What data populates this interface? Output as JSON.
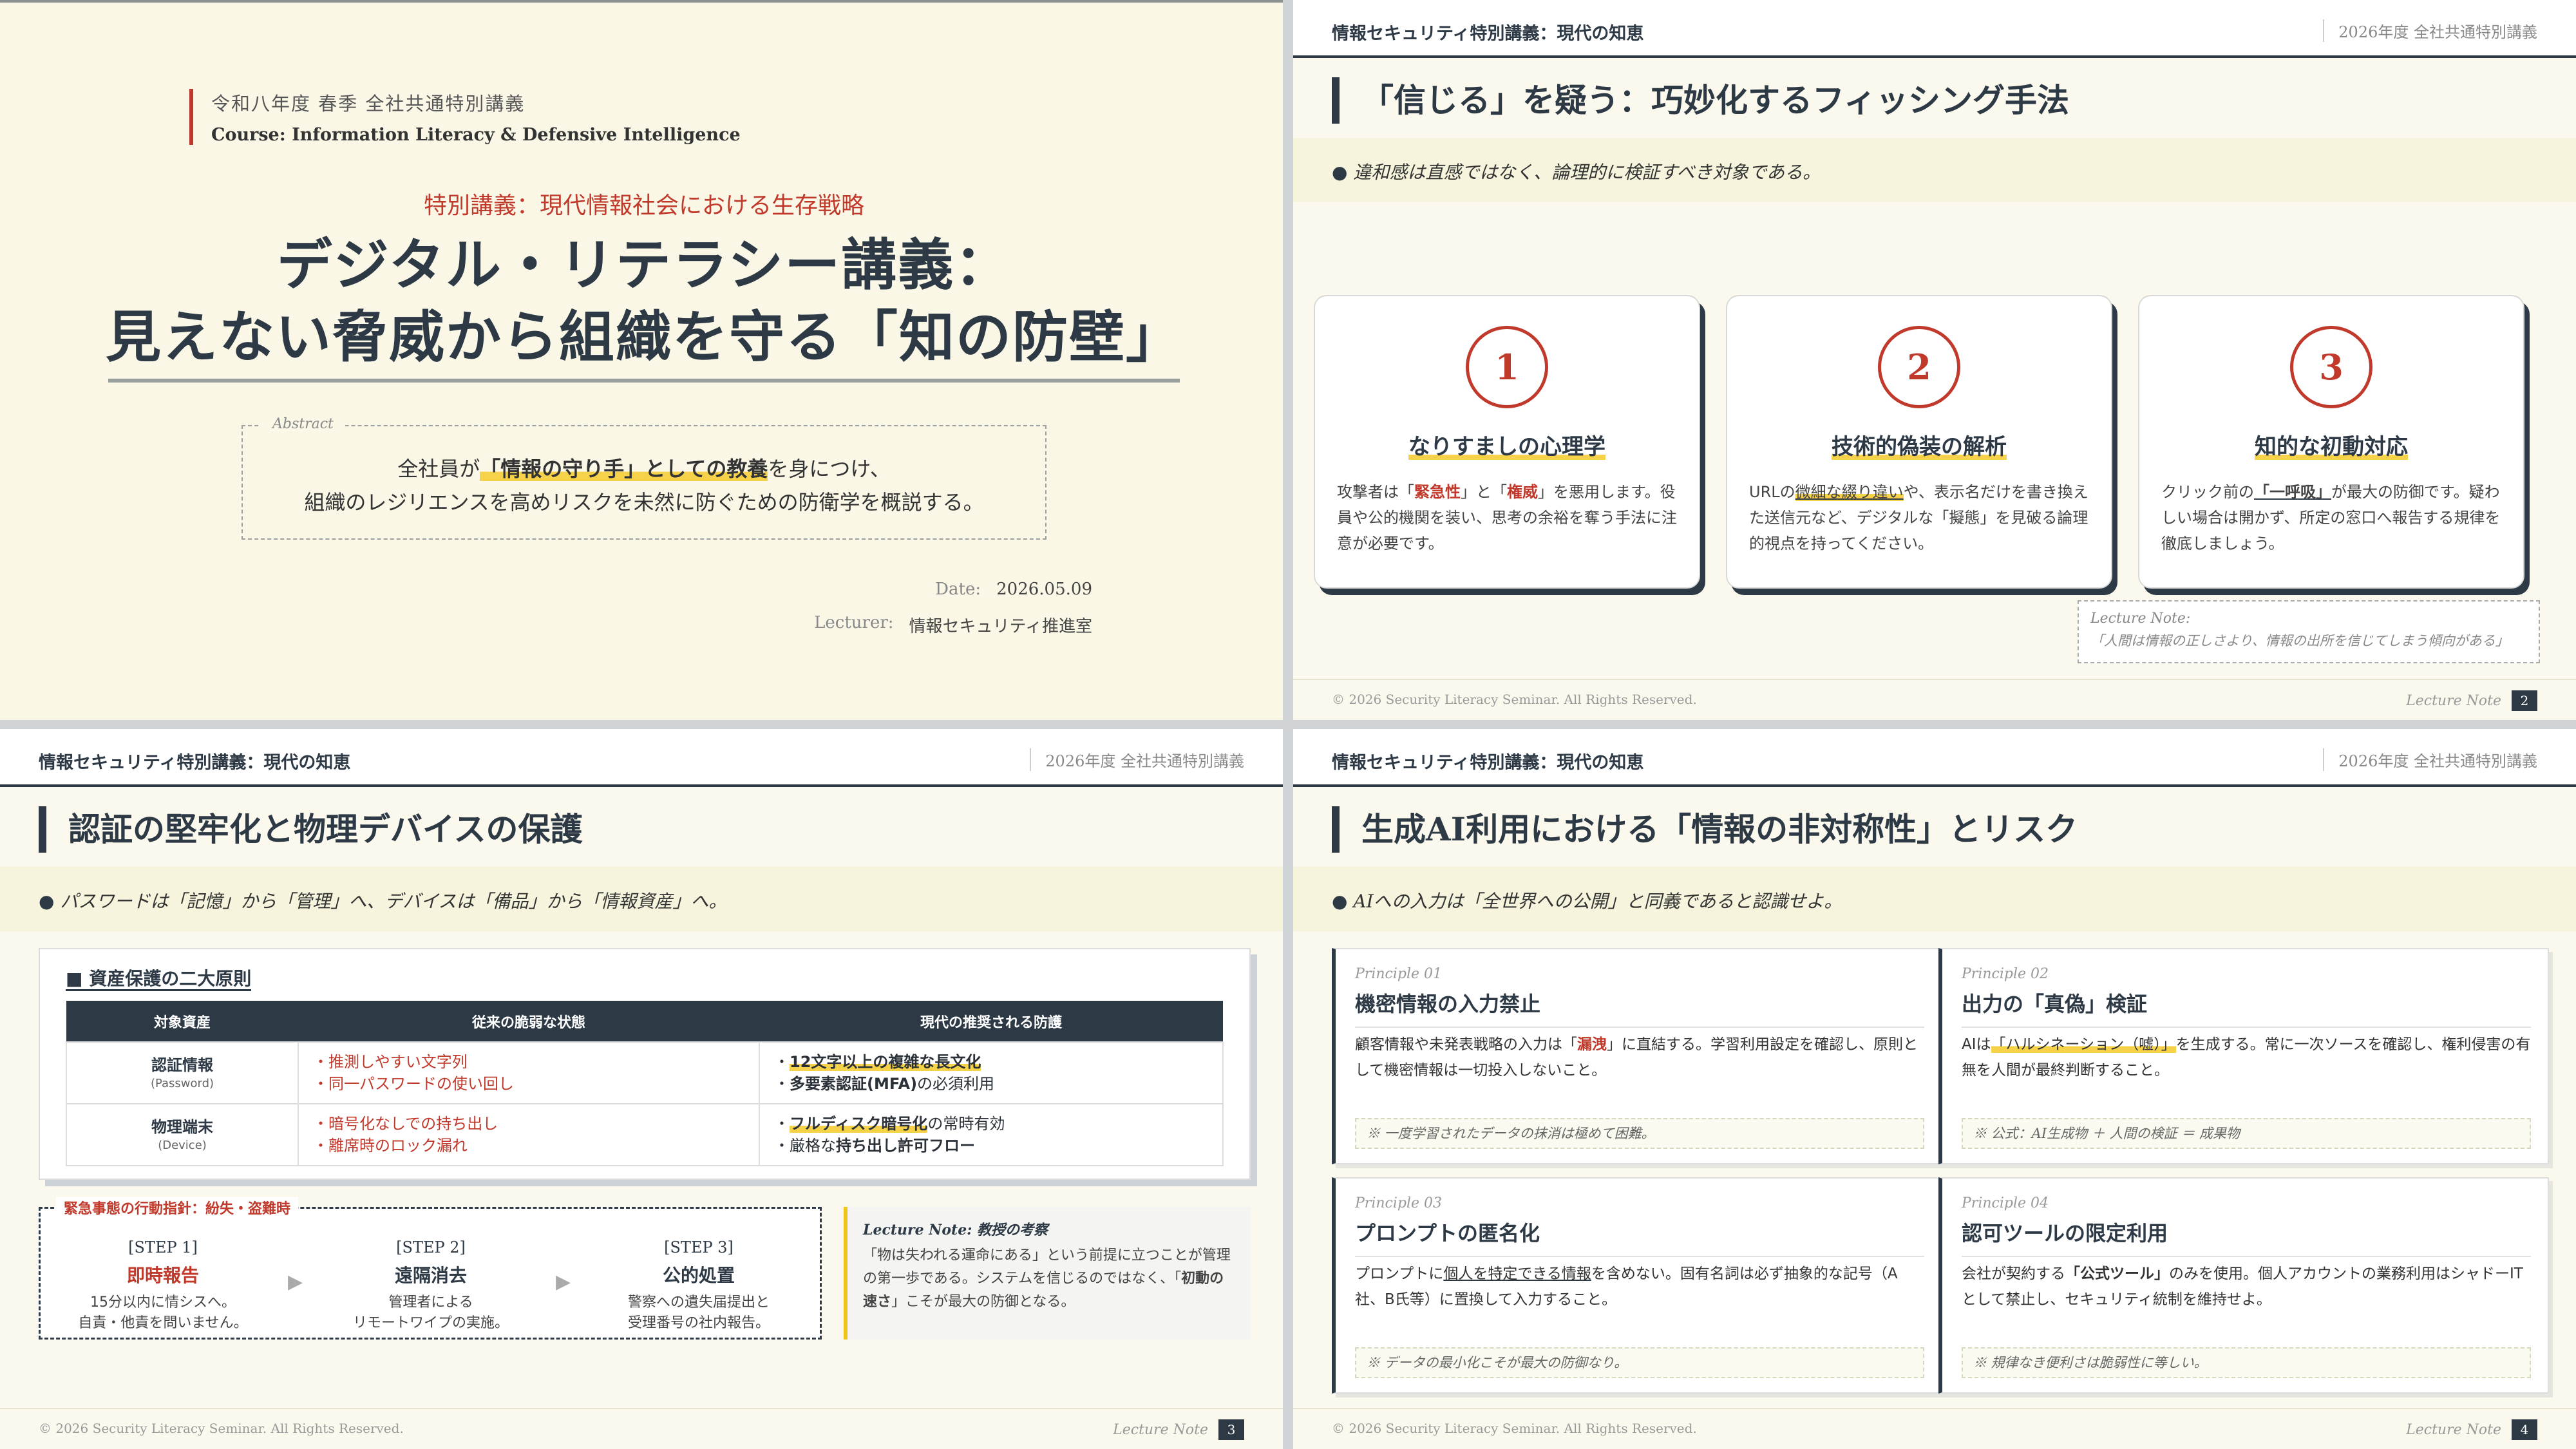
{
  "slide1": {
    "course_jp": "令和八年度 春季 全社共通特別講義",
    "course_en": "Course: Information Literacy & Defensive Intelligence",
    "subtitle": "特別講義：現代情報社会における生存戦略",
    "title_line1": "デジタル・リテラシー講義：",
    "title_line2": "見えない脅威から組織を守る「知の防壁」",
    "abstract_label": "Abstract",
    "abstract_pre": "全社員が",
    "abstract_mark": "「情報の守り手」としての教養",
    "abstract_post": "を身につけ、",
    "abstract_line2": "組織のレジリエンスを高めリスクを未然に防ぐための防衛学を概説する。",
    "date_label": "Date:",
    "date_value": "2026.05.09",
    "lecturer_label": "Lecturer:",
    "lecturer_value": "情報セキュリティ推進室"
  },
  "header": {
    "title": "情報セキュリティ特別講義：現代の知恵",
    "right": "2026年度 全社共通特別講義"
  },
  "footer": {
    "copyright": "© 2026 Security Literacy Seminar. All Rights Reserved.",
    "note": "Lecture Note"
  },
  "slide2": {
    "title": "「信じる」を疑う：巧妙化するフィッシング手法",
    "lead": "違和感は直感ではなく、論理的に検証すべき対象である。",
    "page": "2",
    "cards": [
      {
        "num": "1",
        "heading": "なりすましの心理学",
        "p1": "攻撃者は「",
        "r1": "緊急性",
        "p2": "」と「",
        "r2": "権威",
        "p3": "」を悪用します。役員や公的機関を装い、思考の余裕を奪う手法に注意が必要です。"
      },
      {
        "num": "2",
        "heading": "技術的偽装の解析",
        "p1": "URLの",
        "hl": "微細な綴り違い",
        "p2": "や、表示名だけを書き換えた送信元など、デジタルな「擬態」を見破る論理的視点を持ってください。"
      },
      {
        "num": "3",
        "heading": "知的な初動対応",
        "p1": "クリック前の",
        "ul": "「一呼吸」",
        "p2": "が最大の防御です。疑わしい場合は開かず、所定の窓口へ報告する規律を徹底しましょう。"
      }
    ],
    "note_label": "Lecture Note:",
    "note_text": "「人間は情報の正しさより、情報の出所を信じてしまう傾向がある」"
  },
  "slide3": {
    "title": "認証の堅牢化と物理デバイスの保護",
    "lead": "パスワードは「記憶」から「管理」へ、デバイスは「備品」から「情報資産」へ。",
    "page": "3",
    "table_caption": "■ 資産保護の二大原則",
    "columns": [
      "対象資産",
      "従来の脆弱な状態",
      "現代の推奨される防護"
    ],
    "rows": [
      {
        "asset": "認証情報",
        "asset_en": "(Password)",
        "weak": [
          "・推測しやすい文字列",
          "・同一パスワードの使い回し"
        ],
        "strong1_hl": "12文字以上の複雑な長文化",
        "strong2_b": "多要素認証(MFA)",
        "strong2_rest": "の必須利用"
      },
      {
        "asset": "物理端末",
        "asset_en": "(Device)",
        "weak": [
          "・暗号化なしでの持ち出し",
          "・離席時のロック漏れ"
        ],
        "strong1_hl": "フルディスク暗号化",
        "strong1_rest": "の常時有効",
        "strong2_pre": "厳格な",
        "strong2_b": "持ち出し許可フロー"
      }
    ],
    "emergency_label": "緊急事態の行動指針：紛失・盗難時",
    "steps": [
      {
        "tag": "[STEP 1]",
        "name": "即時報告",
        "l1": "15分以内に情シスへ。",
        "l2": "自責・他責を問いません。"
      },
      {
        "tag": "[STEP 2]",
        "name": "遠隔消去",
        "l1": "管理者による",
        "l2": "リモートワイプの実施。"
      },
      {
        "tag": "[STEP 3]",
        "name": "公的処置",
        "l1": "警察への遺失届提出と",
        "l2": "受理番号の社内報告。"
      }
    ],
    "arrow": "▶",
    "note_label": "Lecture Note: 教授の考察",
    "note_pre": "「物は失われる運命にある」という前提に立つことが管理の第一歩である。システムを信じるのではなく、「",
    "note_b": "初動の速さ",
    "note_post": "」こそが最大の防御となる。"
  },
  "slide4": {
    "title": "生成AI利用における「情報の非対称性」とリスク",
    "lead": "AIへの入力は「全世界への公開」と同義であると認識せよ。",
    "page": "4",
    "principles": [
      {
        "label": "Principle 01",
        "heading": "機密情報の入力禁止",
        "p1": "顧客情報や未発表戦略の入力は「",
        "r": "漏洩",
        "p2": "」に直結する。学習利用設定を確認し、原則として機密情報は一切投入しないこと。",
        "note": "※ 一度学習されたデータの抹消は極めて困難。"
      },
      {
        "label": "Principle 02",
        "heading": "出力の「真偽」検証",
        "p1": "AIは",
        "hl": "「ハルシネーション（嘘）」",
        "p2": "を生成する。常に一次ソースを確認し、権利侵害の有無を人間が最終判断すること。",
        "note": "※ 公式：AI生成物 ＋ 人間の検証 ＝ 成果物"
      },
      {
        "label": "Principle 03",
        "heading": "プロンプトの匿名化",
        "p1": "プロンプトに",
        "ul": "個人を特定できる情報",
        "p2": "を含めない。固有名詞は必ず抽象的な記号（A社、B氏等）に置換して入力すること。",
        "note": "※ データの最小化こそが最大の防御なり。"
      },
      {
        "label": "Principle 04",
        "heading": "認可ツールの限定利用",
        "p1": "会社が契約する",
        "b": "「公式ツール」",
        "p2": "のみを使用。個人アカウントの業務利用はシャドーITとして禁止し、セキュリティ統制を維持せよ。",
        "note": "※ 規律なき便利さは脆弱性に等しい。"
      }
    ]
  }
}
